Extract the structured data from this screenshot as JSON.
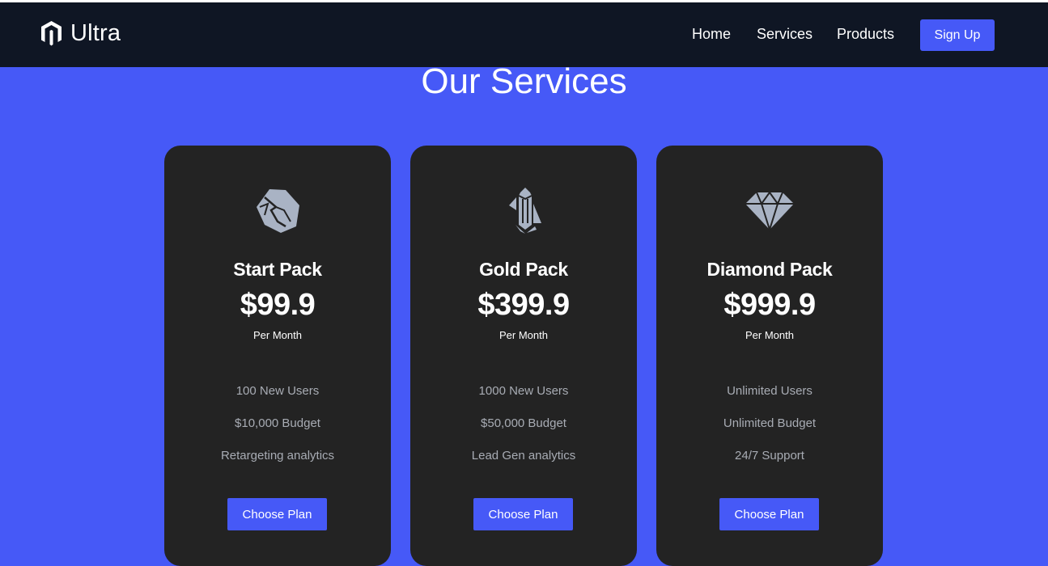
{
  "brand": {
    "name": "Ultra",
    "icon": "hexagon-m-logo-icon"
  },
  "nav": {
    "links": [
      "Home",
      "Services",
      "Products"
    ],
    "signup_label": "Sign Up"
  },
  "section": {
    "title": "Our Services"
  },
  "plans": [
    {
      "icon": "rock-icon",
      "name": "Start Pack",
      "price": "$99.9",
      "period": "Per Month",
      "features": [
        "100 New Users",
        "$10,000 Budget",
        "Retargeting analytics"
      ],
      "button": "Choose Plan"
    },
    {
      "icon": "crystal-icon",
      "name": "Gold Pack",
      "price": "$399.9",
      "period": "Per Month",
      "features": [
        "1000 New Users",
        "$50,000 Budget",
        "Lead Gen analytics"
      ],
      "button": "Choose Plan"
    },
    {
      "icon": "diamond-icon",
      "name": "Diamond Pack",
      "price": "$999.9",
      "period": "Per Month",
      "features": [
        "Unlimited Users",
        "Unlimited Budget",
        "24/7 Support"
      ],
      "button": "Choose Plan"
    }
  ],
  "colors": {
    "accent": "#4659f7",
    "navbar": "#0f1624",
    "card": "#232323",
    "icon": "#a9b3c4",
    "feature_text": "#a8acb4"
  }
}
